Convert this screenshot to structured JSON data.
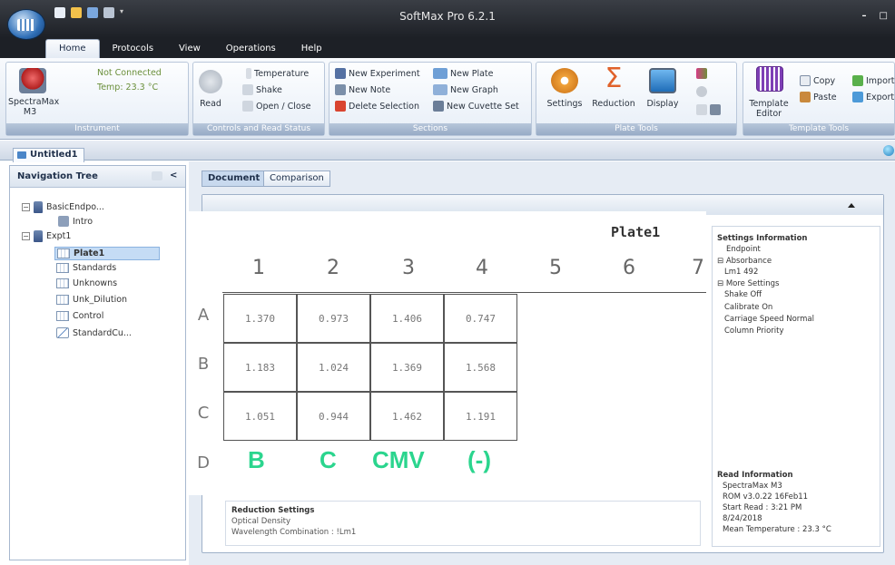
{
  "window": {
    "title": "SoftMax Pro 6.2.1",
    "minimize": "–",
    "maximize": "□"
  },
  "ribbon_tabs": [
    "Home",
    "Protocols",
    "View",
    "Operations",
    "Help"
  ],
  "instrument": {
    "name": "SpectraMax\nM3",
    "status": "Not Connected",
    "temp": "Temp: 23.3 °C",
    "group_label": "Instrument"
  },
  "controls": {
    "read": "Read",
    "temperature": "Temperature",
    "shake": "Shake",
    "open_close": "Open / Close",
    "group_label": "Controls and Read Status"
  },
  "sections": {
    "new_experiment": "New Experiment",
    "new_plate": "New Plate",
    "new_note": "New Note",
    "new_graph": "New Graph",
    "delete_selection": "Delete Selection",
    "new_cuvette_set": "New Cuvette Set",
    "group_label": "Sections"
  },
  "plate_tools": {
    "settings": "Settings",
    "reduction": "Reduction",
    "display": "Display",
    "group_label": "Plate Tools"
  },
  "template_tools": {
    "template_editor": "Template\nEditor",
    "copy": "Copy",
    "paste": "Paste",
    "import": "Import",
    "export": "Export",
    "group_label": "Template Tools"
  },
  "document_tab": "Untitled1",
  "nav": {
    "title": "Navigation Tree",
    "collapse": "<",
    "items": [
      {
        "label": "BasicEndpo...",
        "level": 0
      },
      {
        "label": "Intro",
        "level": 1
      },
      {
        "label": "Expt1",
        "level": 0
      },
      {
        "label": "Plate1",
        "level": 1
      },
      {
        "label": "Standards",
        "level": 1
      },
      {
        "label": "Unknowns",
        "level": 1
      },
      {
        "label": "Unk_Dilution",
        "level": 1
      },
      {
        "label": "Control",
        "level": 1
      },
      {
        "label": "StandardCu...",
        "level": 1
      }
    ]
  },
  "main_tabs": [
    "Document",
    "Comparison"
  ],
  "plate": {
    "title": "Plate1",
    "columns": [
      "1",
      "2",
      "3",
      "4",
      "5",
      "6",
      "7"
    ],
    "rows": [
      "A",
      "B",
      "C",
      "D"
    ],
    "values": [
      [
        "1.370",
        "0.973",
        "1.406",
        "0.747"
      ],
      [
        "1.183",
        "1.024",
        "1.369",
        "1.568"
      ],
      [
        "1.051",
        "0.944",
        "1.462",
        "1.191"
      ]
    ],
    "annotations": [
      "B",
      "C",
      "CMV",
      "(-)"
    ],
    "annotation_color": "#2bd58e"
  },
  "settings_info": {
    "title": "Settings Information",
    "lines": [
      "Endpoint",
      "⊟ Absorbance",
      "Lm1  492",
      "⊟ More Settings",
      "Shake  Off",
      "Calibrate  On",
      "Carriage Speed  Normal",
      "Column Priority"
    ]
  },
  "read_info": {
    "title": "Read Information",
    "lines": [
      "SpectraMax M3",
      "ROM v3.0.22 16Feb11",
      "Start Read : 3:21 PM",
      "8/24/2018",
      "Mean Temperature : 23.3 °C"
    ]
  },
  "reduction_settings": {
    "title": "Reduction Settings",
    "lines": [
      "Optical Density",
      "Wavelength Combination : !Lm1"
    ]
  }
}
